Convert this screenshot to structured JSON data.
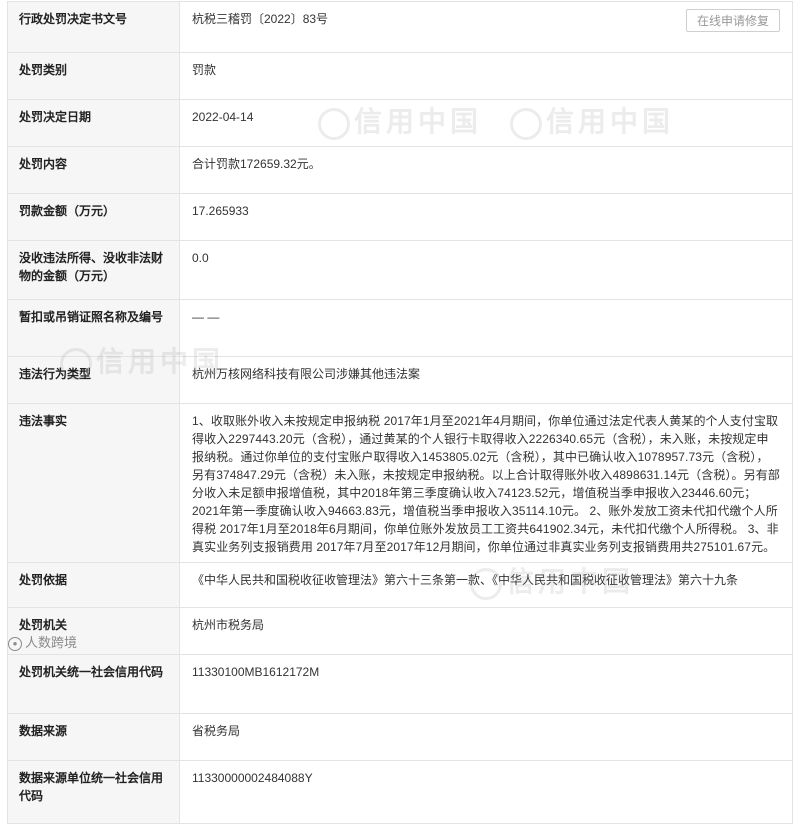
{
  "actions": {
    "repair_label": "在线申请修复"
  },
  "watermark": {
    "text": "信用中国"
  },
  "credit": {
    "text": "人数跨境"
  },
  "rows": [
    {
      "label": "行政处罚决定书文号",
      "value": "杭税三稽罚〔2022〕83号"
    },
    {
      "label": "处罚类别",
      "value": "罚款"
    },
    {
      "label": "处罚决定日期",
      "value": "2022-04-14"
    },
    {
      "label": "处罚内容",
      "value": "合计罚款172659.32元。"
    },
    {
      "label": "罚款金额（万元）",
      "value": "17.265933"
    },
    {
      "label": "没收违法所得、没收非法财物的金额（万元）",
      "value": "0.0"
    },
    {
      "label": "暂扣或吊销证照名称及编号",
      "value": "— —"
    },
    {
      "label": "违法行为类型",
      "value": "杭州万核网络科技有限公司涉嫌其他违法案"
    },
    {
      "label": "违法事实",
      "value": "1、收取账外收入未按规定申报纳税 2017年1月至2021年4月期间，你单位通过法定代表人黄某的个人支付宝取得收入2297443.20元（含税），通过黄某的个人银行卡取得收入2226340.65元（含税），未入账，未按规定申报纳税。通过你单位的支付宝账户取得收入1453805.02元（含税），其中已确认收入1078957.73元（含税），另有374847.29元（含税）未入账，未按规定申报纳税。以上合计取得账外收入4898631.14元（含税）。另有部分收入未足额申报增值税，其中2018年第三季度确认收入74123.52元，增值税当季申报收入23446.60元；2021年第一季度确认收入94663.83元，增值税当季申报收入35114.10元。 2、账外发放工资未代扣代缴个人所得税 2017年1月至2018年6月期间，你单位账外发放员工工资共641902.34元，未代扣代缴个人所得税。 3、非真实业务列支报销费用 2017年7月至2017年12月期间，你单位通过非真实业务列支报销费用共275101.67元。"
    },
    {
      "label": "处罚依据",
      "value": "《中华人民共和国税收征收管理法》第六十三条第一款、《中华人民共和国税收征收管理法》第六十九条"
    },
    {
      "label": "处罚机关",
      "value": "杭州市税务局"
    },
    {
      "label": "处罚机关统一社会信用代码",
      "value": "11330100MB1612172M"
    },
    {
      "label": "数据来源",
      "value": "省税务局"
    },
    {
      "label": "数据来源单位统一社会信用代码",
      "value": "11330000002484088Y"
    }
  ]
}
